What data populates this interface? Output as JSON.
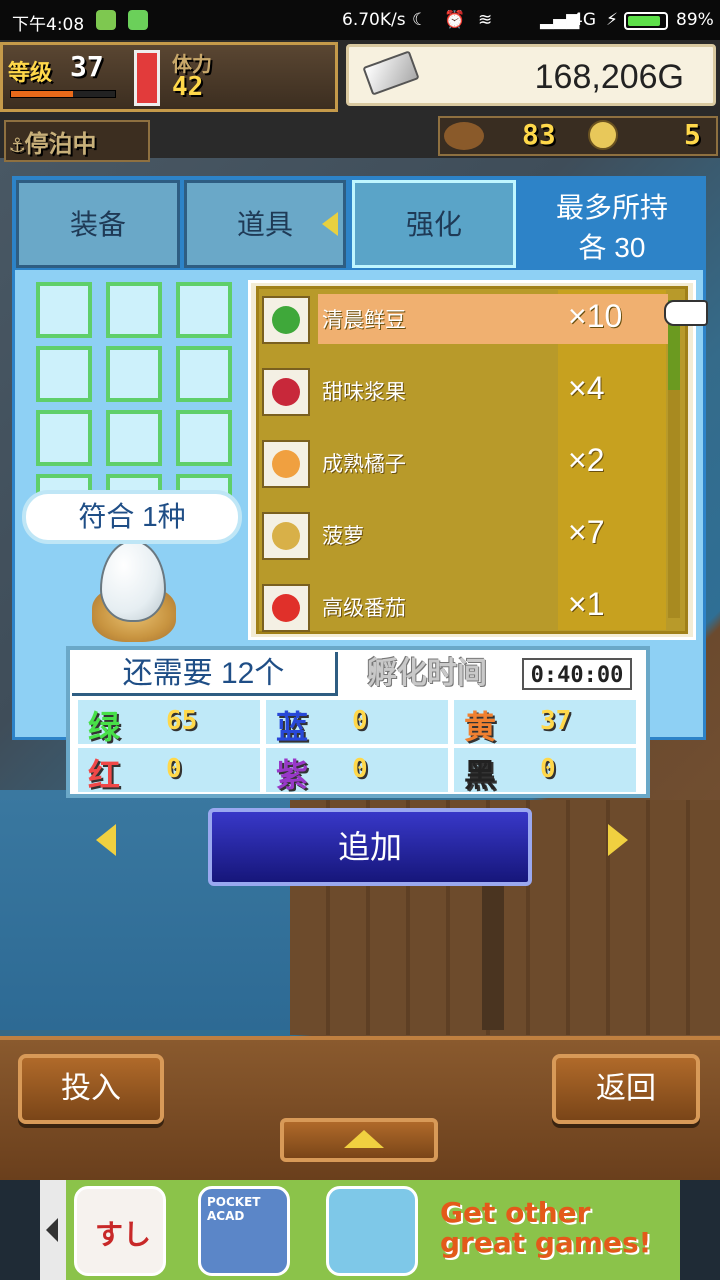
{
  "status_bar": {
    "time": "下午4:08",
    "net_speed": "6.70K/s",
    "network": "4G",
    "battery": "89%",
    "battery_level": 0.89
  },
  "hud": {
    "level_label": "等级",
    "level_value": "37",
    "level_progress": 0.6,
    "stamina_label": "体力",
    "stamina_value": "42",
    "gold": "168,206G",
    "port_status": "停泊中",
    "food_value": "83",
    "coin_value": "5"
  },
  "tabs": {
    "equip": "装备",
    "items": "道具",
    "enhance": "强化",
    "active": "enhance",
    "max_hold_line1": "最多所持",
    "max_hold_line2": "各 30"
  },
  "match_badge": "符合 1种",
  "items": [
    {
      "name": "清晨鲜豆",
      "qty": "×10",
      "color": "#3fa83a",
      "selected": true
    },
    {
      "name": "甜味浆果",
      "qty": "×4",
      "color": "#c8283a",
      "selected": false
    },
    {
      "name": "成熟橘子",
      "qty": "×2",
      "color": "#f0a040",
      "selected": false
    },
    {
      "name": "菠萝",
      "qty": "×7",
      "color": "#d8b048",
      "selected": false
    },
    {
      "name": "高级番茄",
      "qty": "×1",
      "color": "#e0302a",
      "selected": false
    }
  ],
  "requirement": {
    "need_text": "还需要 12个",
    "hatch_label": "孵化时间",
    "hatch_time": "0:40:00"
  },
  "colors": [
    {
      "label": "绿",
      "value": "65",
      "color": "#48e048"
    },
    {
      "label": "蓝",
      "value": "0",
      "color": "#2848d8"
    },
    {
      "label": "黄",
      "value": "37",
      "color": "#f08030"
    },
    {
      "label": "红",
      "value": "0",
      "color": "#f04848"
    },
    {
      "label": "紫",
      "value": "0",
      "color": "#9838c8"
    },
    {
      "label": "黑",
      "value": "0",
      "color": "#222222"
    }
  ],
  "buttons": {
    "add": "追加",
    "insert": "投入",
    "back": "返回"
  },
  "ad": {
    "app1_label": "すし",
    "app2_label": "POCKET ACAD",
    "text": "Get other great games!"
  }
}
